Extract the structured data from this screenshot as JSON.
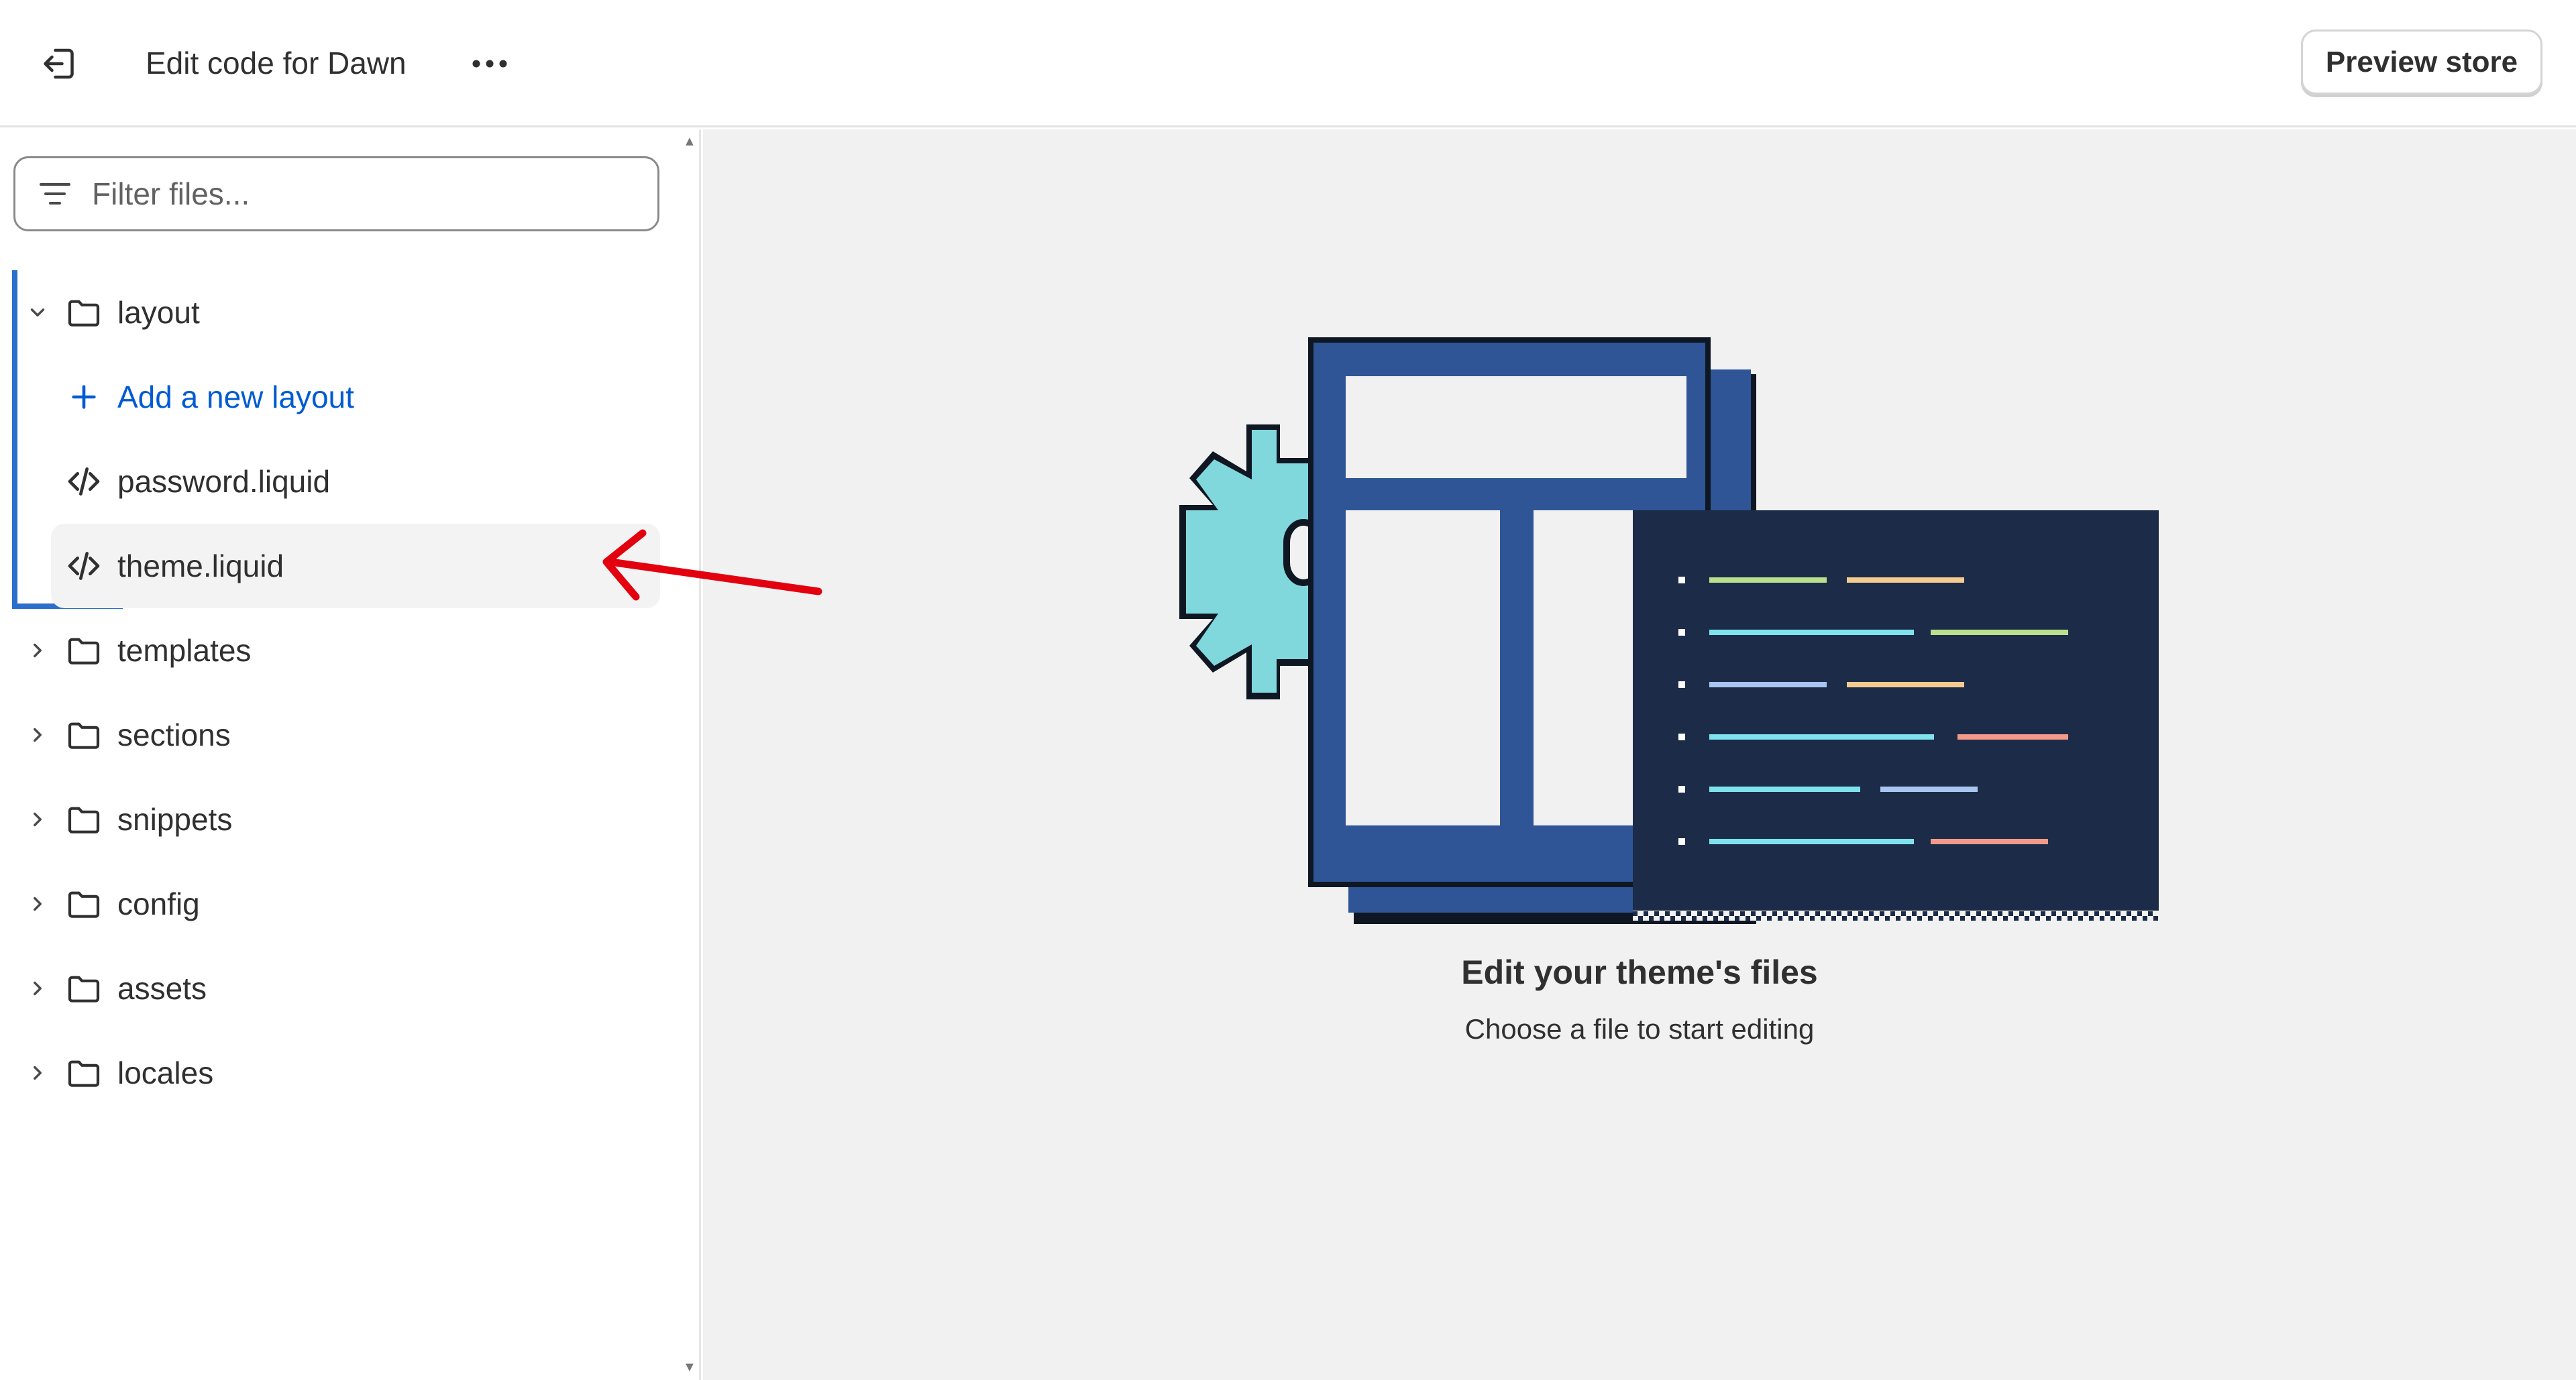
{
  "topbar": {
    "title": "Edit code for Dawn",
    "exit_icon": "exit-icon",
    "more_icon": "more-horizontal-icon",
    "preview_label": "Preview store"
  },
  "sidebar": {
    "filter": {
      "placeholder": "Filter files...",
      "value": "",
      "icon": "filter-icon"
    },
    "layout_folder": "layout",
    "add_layout": "Add a new layout",
    "files": [
      "password.liquid",
      "theme.liquid"
    ],
    "folders": [
      "templates",
      "sections",
      "snippets",
      "config",
      "assets",
      "locales"
    ]
  },
  "main": {
    "empty_title": "Edit your theme's files",
    "empty_subtitle": "Choose a file to start editing"
  },
  "colors": {
    "accent": "#2c6ecb",
    "link": "#005bd3",
    "annotation": "#e3000f",
    "illus_blue": "#2f5597",
    "illus_dark": "#1c2b47",
    "illus_cyan": "#80d8dd"
  }
}
